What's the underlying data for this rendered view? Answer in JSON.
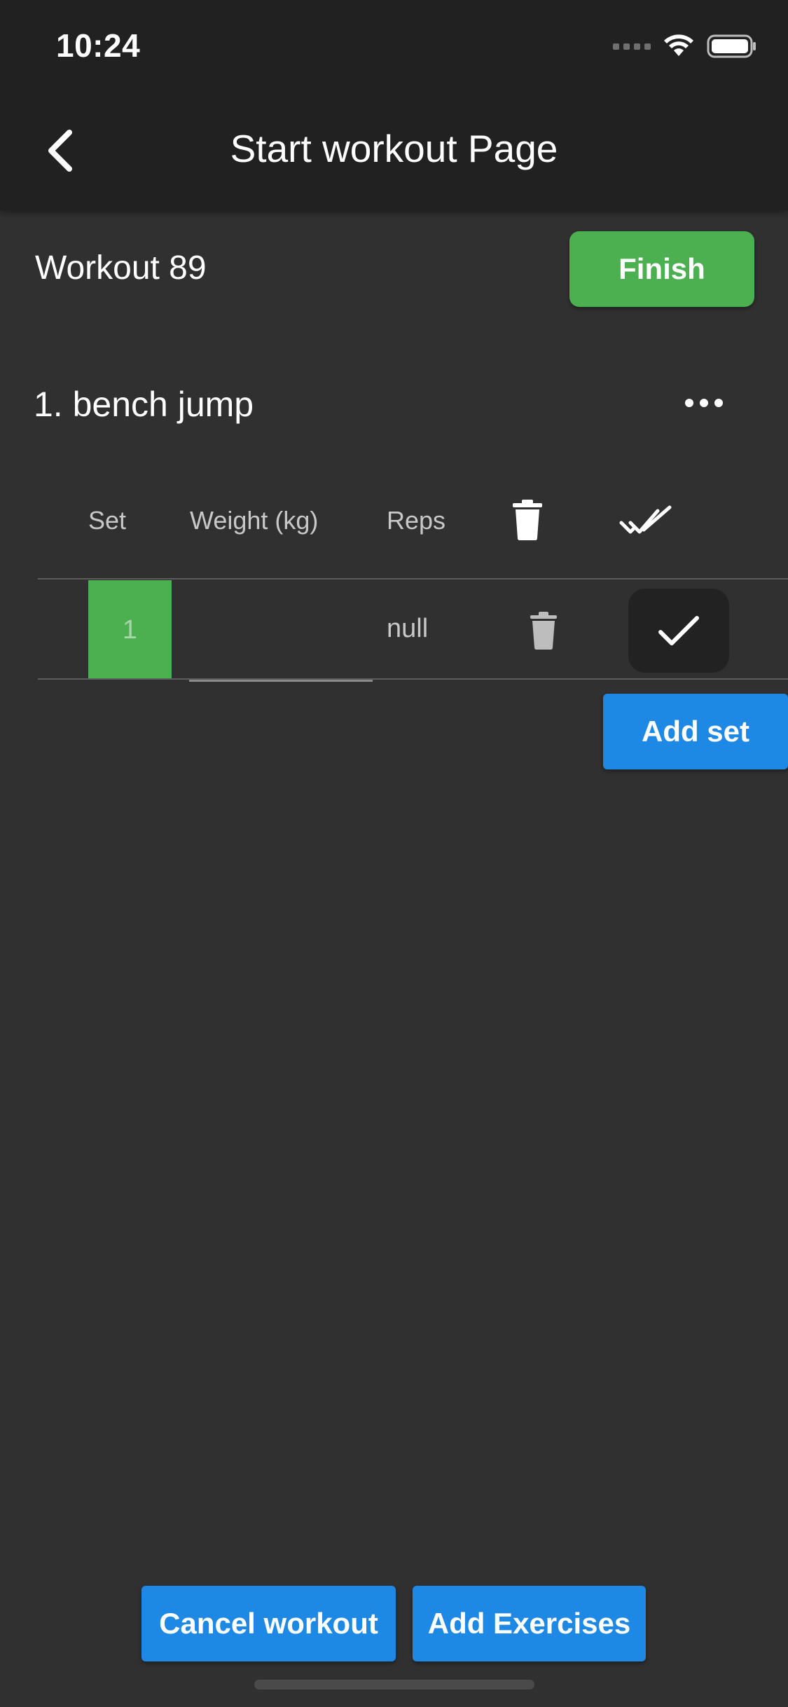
{
  "status_bar": {
    "time": "10:24",
    "icons": [
      "cellular-signal-icon",
      "wifi-icon",
      "battery-icon"
    ]
  },
  "app_bar": {
    "back_icon": "chevron-left-icon",
    "title": "Start workout Page"
  },
  "workout": {
    "name": "Workout 89",
    "finish_label": "Finish"
  },
  "exercise": {
    "name": "1. bench jump",
    "more_icon": "more-horizontal-icon"
  },
  "table": {
    "headers": {
      "set": "Set",
      "weight": "Weight (kg)",
      "reps": "Reps",
      "delete_icon": "trash-icon",
      "complete_all_icon": "double-check-icon"
    },
    "rows": [
      {
        "set": "1",
        "weight": "",
        "reps": "null",
        "delete_icon": "trash-icon",
        "complete_icon": "check-icon"
      }
    ]
  },
  "actions": {
    "add_set_label": "Add set",
    "cancel_label": "Cancel workout",
    "add_exercises_label": "Add Exercises"
  },
  "colors": {
    "background": "#303030",
    "app_bar": "#212121",
    "success": "#4caf50",
    "primary": "#1e88e5"
  }
}
